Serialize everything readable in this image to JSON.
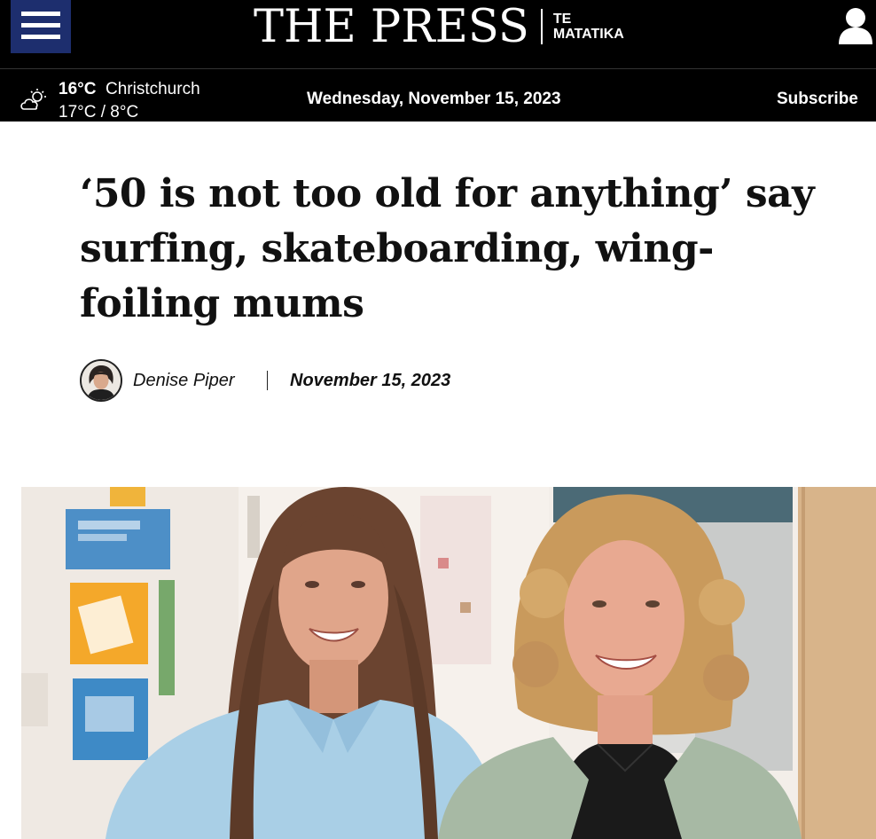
{
  "header": {
    "brand_title": "THE PRESS",
    "brand_sub_line1": "TE",
    "brand_sub_line2": "MATATIKA",
    "menu_icon": "hamburger-menu-icon",
    "user_icon": "user-account-icon",
    "nav_color": "#1d2e6e"
  },
  "infobar": {
    "weather_icon": "partly-cloudy-icon",
    "temp_now": "16°C",
    "city": "Christchurch",
    "temp_range": "17°C / 8°C",
    "date": "Wednesday, November 15, 2023",
    "subscribe_label": "Subscribe"
  },
  "article": {
    "headline": "‘50 is not too old for anything’ say surfing, skateboarding, wing-foiling mums",
    "author": "Denise Piper",
    "date": "November 15, 2023"
  }
}
